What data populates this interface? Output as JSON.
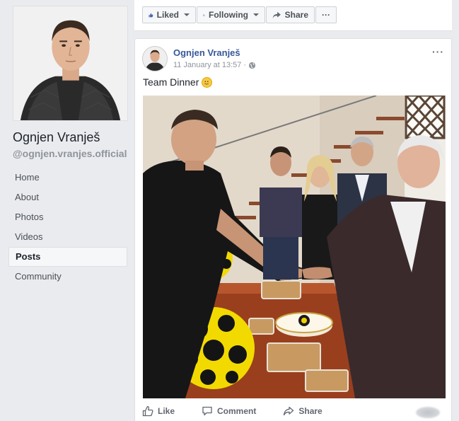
{
  "profile": {
    "name": "Ognjen Vranješ",
    "username": "@ognjen.vranjes.official"
  },
  "nav": {
    "items": [
      {
        "label": "Home",
        "active": false
      },
      {
        "label": "About",
        "active": false
      },
      {
        "label": "Photos",
        "active": false
      },
      {
        "label": "Videos",
        "active": false
      },
      {
        "label": "Posts",
        "active": true
      },
      {
        "label": "Community",
        "active": false
      }
    ]
  },
  "actionbar": {
    "liked_label": "Liked",
    "following_label": "Following",
    "share_label": "Share",
    "more_label": "···"
  },
  "post": {
    "author": "Ognjen Vranješ",
    "timestamp": "11 January at 13:57",
    "separator": "·",
    "text": "Team Dinner",
    "more_label": "···",
    "actions": {
      "like": "Like",
      "comment": "Comment",
      "share": "Share"
    }
  },
  "colors": {
    "link": "#365899",
    "background": "#e9ebee",
    "meta": "#90949c"
  }
}
